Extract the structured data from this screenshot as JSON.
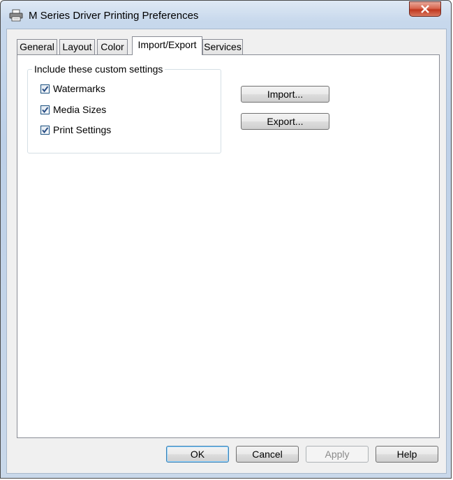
{
  "window": {
    "title": "M Series Driver Printing Preferences"
  },
  "icons": {
    "app": "printer-icon",
    "close": "close-icon",
    "check": "checkmark-icon"
  },
  "tabs": [
    {
      "label": "General"
    },
    {
      "label": "Layout"
    },
    {
      "label": "Color"
    },
    {
      "label": "Import/Export"
    },
    {
      "label": "Services"
    }
  ],
  "active_tab": "Import/Export",
  "group": {
    "legend": "Include these custom settings",
    "items": [
      {
        "label": "Watermarks",
        "checked": true
      },
      {
        "label": "Media Sizes",
        "checked": true
      },
      {
        "label": "Print Settings",
        "checked": true
      }
    ]
  },
  "actions": {
    "import_label": "Import...",
    "export_label": "Export..."
  },
  "footer": {
    "ok_label": "OK",
    "cancel_label": "Cancel",
    "apply_label": "Apply",
    "help_label": "Help"
  },
  "colors": {
    "close_button": "#c7412b",
    "default_button_border": "#3c7fb1",
    "window_frame": "#bdd0e8"
  }
}
